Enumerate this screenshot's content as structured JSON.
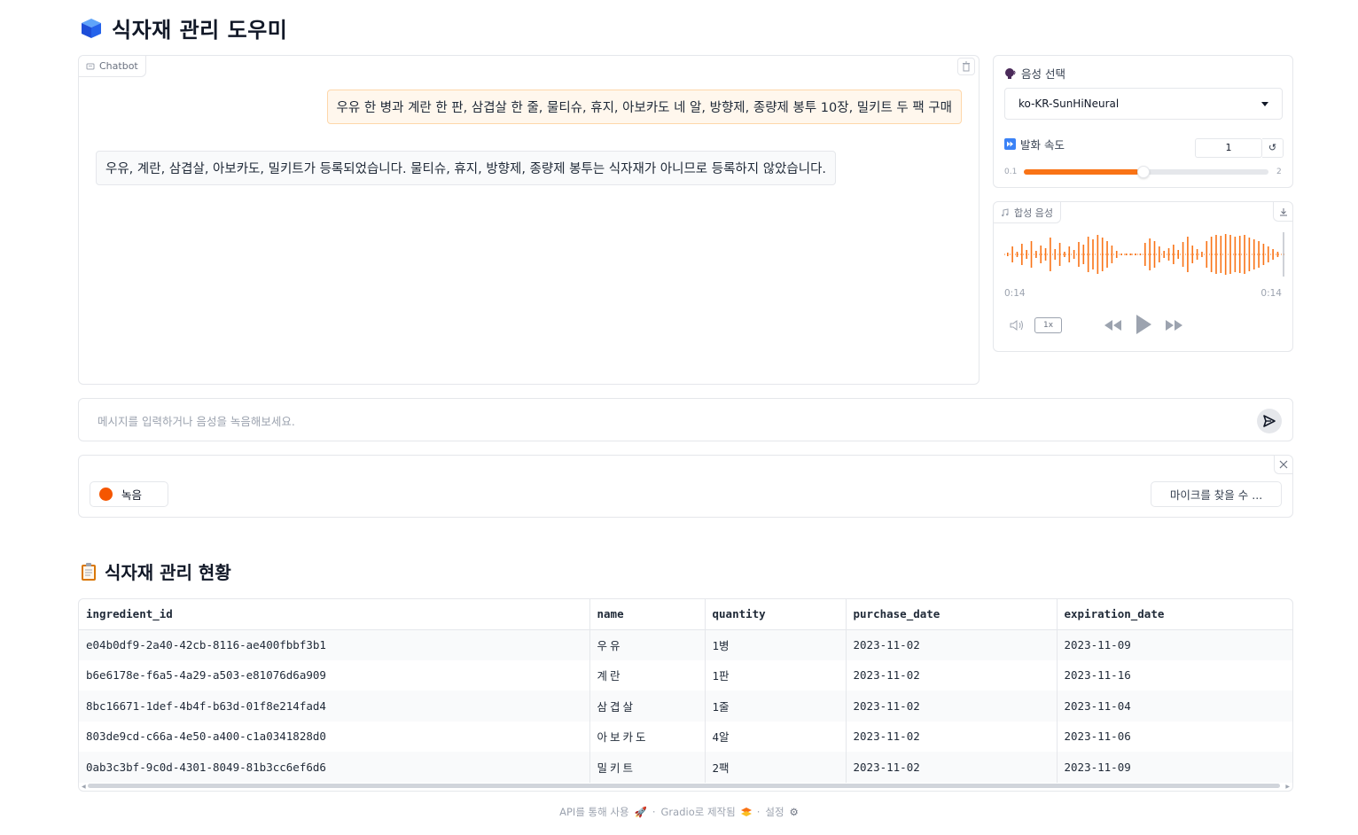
{
  "app": {
    "title": "식자재 관리 도우미",
    "title_icon": "cube-icon"
  },
  "chatbot": {
    "label": "Chatbot",
    "messages": [
      {
        "role": "user",
        "text": "우유 한 병과 계란 한 판, 삼겹살 한 줄, 물티슈, 휴지, 아보카도 네 알, 방향제, 종량제 봉투 10장, 밀키트 두 팩 구매"
      },
      {
        "role": "bot",
        "text": "우유, 계란, 삼겹살, 아보카도, 밀키트가 등록되었습니다. 물티슈, 휴지, 방향제, 종량제 봉투는 식자재가 아니므로 등록하지 않았습니다."
      }
    ]
  },
  "voice": {
    "label": "음성 선택",
    "selected": "ko-KR-SunHiNeural",
    "speed_label": "발화 속도",
    "speed_value": "1",
    "speed_min": "0.1",
    "speed_max": "2",
    "speed_fraction": 0.47
  },
  "audio": {
    "label": "합성 음성",
    "time_current": "0:14",
    "time_total": "0:14",
    "playback_rate": "1x",
    "accent": "#f97316"
  },
  "input": {
    "placeholder": "메시지를 입력하거나 음성을 녹음해보세요."
  },
  "recorder": {
    "record_label": "녹음",
    "mic_label": "마이크를 찾을 수 ..."
  },
  "inventory": {
    "title": "식자재 관리 현황",
    "columns": [
      "ingredient_id",
      "name",
      "quantity",
      "purchase_date",
      "expiration_date"
    ],
    "rows": [
      [
        "e04b0df9-2a40-42cb-8116-ae400fbbf3b1",
        "우유",
        "1병",
        "2023-11-02",
        "2023-11-09"
      ],
      [
        "b6e6178e-f6a5-4a29-a503-e81076d6a909",
        "계란",
        "1판",
        "2023-11-02",
        "2023-11-16"
      ],
      [
        "8bc16671-1def-4b4f-b63d-01f8e214fad4",
        "삼겹살",
        "1줄",
        "2023-11-02",
        "2023-11-04"
      ],
      [
        "803de9cd-c66a-4e50-a400-c1a0341828d0",
        "아보카도",
        "4알",
        "2023-11-02",
        "2023-11-06"
      ],
      [
        "0ab3c3bf-9c0d-4301-8049-81b3cc6ef6d6",
        "밀키트",
        "2팩",
        "2023-11-02",
        "2023-11-09"
      ]
    ]
  },
  "footer": {
    "api": "API를 통해 사용",
    "built": "Gradio로 제작됨",
    "settings": "설정"
  }
}
